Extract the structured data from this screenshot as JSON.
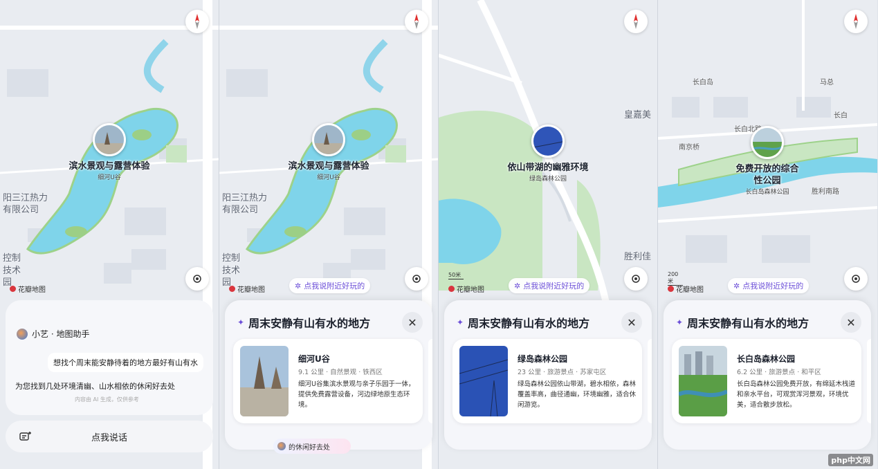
{
  "panel1": {
    "pin_title": "滨水景观与露营体验",
    "pin_sub": "细河U谷",
    "map_labels": [
      "阳三江热力",
      "有限公司",
      "控制",
      "技术",
      "园"
    ],
    "brand": "花瓣地图",
    "assistant_name": "小艺 · 地图助手",
    "user_query": "想找个周末能安静待着的地方最好有山有水",
    "reply": "为您找到几处环境清幽、山水相依的休闲好去处",
    "disclaimer": "内容由 AI 生成，仅供参考",
    "talk_label": "点我说话"
  },
  "panel2": {
    "pin_title": "滨水景观与露营体验",
    "pin_sub": "细河U谷",
    "map_labels": [
      "阳三江热力",
      "有限公司",
      "控制",
      "技术",
      "园"
    ],
    "brand": "花瓣地图",
    "chip": "点我说附近好玩的",
    "sheet_title": "周末安静有山有水的地方",
    "card": {
      "name": "细河U谷",
      "meta": "9.1 公里 · 自然景观 · 铁西区",
      "desc": "细河U谷集滨水景观与亲子乐园于一体，提供免费露营设备，河边绿地原生态环境。"
    },
    "floating_text": "的休闲好去处"
  },
  "panel3": {
    "pin_title": "依山带湖的幽雅环境",
    "pin_sub": "绿岛森林公园",
    "map_labels": [
      "皇嘉美",
      "胜利佳"
    ],
    "scale": "50米",
    "brand": "花瓣地图",
    "chip": "点我说附近好玩的",
    "sheet_title": "周末安静有山有水的地方",
    "card": {
      "name": "绿岛森林公园",
      "meta": "23 公里 · 旅游景点 · 苏家屯区",
      "desc": "绿岛森林公园依山带湖，碧水相依，森林覆盖率高，曲径通幽，环境幽雅，适合休闲游览。"
    }
  },
  "panel4": {
    "pin_title": "免费开放的综合性公园",
    "pin_title_l1": "免费开放的综合",
    "pin_title_l2": "性公园",
    "pin_sub": "长白岛森林公园",
    "map_labels": [
      "长白岛",
      "马总",
      "南京桥",
      "长白",
      "长白北路",
      "胜利南路"
    ],
    "scale": "200米",
    "brand": "花瓣地图",
    "chip": "点我说附近好玩的",
    "sheet_title": "周末安静有山有水的地方",
    "card": {
      "name": "长白岛森林公园",
      "meta": "6.2 公里 · 旅游景点 · 和平区",
      "desc": "长白岛森林公园免费开放，有绵延木栈道和亲水平台，可观赏浑河景观，环境优美，适合散步放松。"
    },
    "watermark": "php中文网"
  },
  "icons": {
    "compass": "compass-icon",
    "locate": "locate-icon",
    "sparkle": "sparkle-icon",
    "close": "close-icon",
    "mic": "mic-icon"
  },
  "colors": {
    "water": "#7fd4ea",
    "park": "#c9e6c2",
    "accent": "#6c4fd8",
    "road": "#ffffff"
  }
}
